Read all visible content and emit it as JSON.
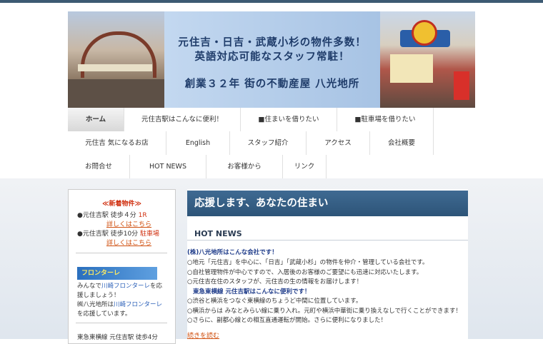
{
  "header": {
    "line1": "元住吉・日吉・武蔵小杉の物件多数！",
    "line2": "英語対応可能なスタッフ常駐！",
    "line3": "創業３２年 街の不動産屋 八光地所"
  },
  "nav": {
    "row1": [
      "ホーム",
      "元住吉駅はこんなに便利！",
      "■住まいを借りたい",
      "■駐車場を借りたい"
    ],
    "row2": [
      "元住吉 気になるお店",
      "English",
      "スタッフ紹介",
      "アクセス",
      "会社概要"
    ],
    "row3": [
      "お問合せ",
      "HOT NEWS",
      "お客様から",
      "リンク"
    ]
  },
  "sidebar": {
    "title": "≪新着物件≫",
    "item1_main": "●元住吉駅 徒歩４分",
    "item1_tag": "1R",
    "item1_link": "詳しくはこちら",
    "item2_main": "●元住吉駅 徒歩10分",
    "item2_tag": "駐車場",
    "item2_link": "詳しくはこちら",
    "banner": "フロンターレ",
    "support1_a": "みんなで",
    "support1_b": "川崎フロンターレ",
    "support1_c": "を応",
    "support2": "援しましょう！",
    "support3_a": "㈱八光地所は",
    "support3_b": "川崎フロンターレ",
    "support4": "を応援しています。",
    "footer_text": "東急東横線 元住吉駅 徒歩4分"
  },
  "main": {
    "title": "応援します、あなたの住まい",
    "section": "HOT NEWS",
    "lead": "(株)八光地所はこんな会社です！",
    "lines": [
      "○地元「元住吉」を中心に、「日吉」「武蔵小杉」の物件を仲介・管理している会社です。",
      "○自社管理物件が中心ですので、入居後のお客様のご要望にも迅速に対応いたします。",
      "○元住吉在住のスタッフが、元住吉の生の情報をお届けします！"
    ],
    "sub": "東急東横線 元住吉駅はこんなに便利です！",
    "lines2": [
      "○渋谷と横浜をつなぐ東横線のちょうど中間に位置しています。",
      "○横浜からは みなとみらい線に乗り入れ。元町や横浜中華街に乗り換えなしで行くことができます！",
      "○さらに、副都心線との相互直通運転が開始。さらに便利になりました！"
    ],
    "more": "続きを読む"
  }
}
